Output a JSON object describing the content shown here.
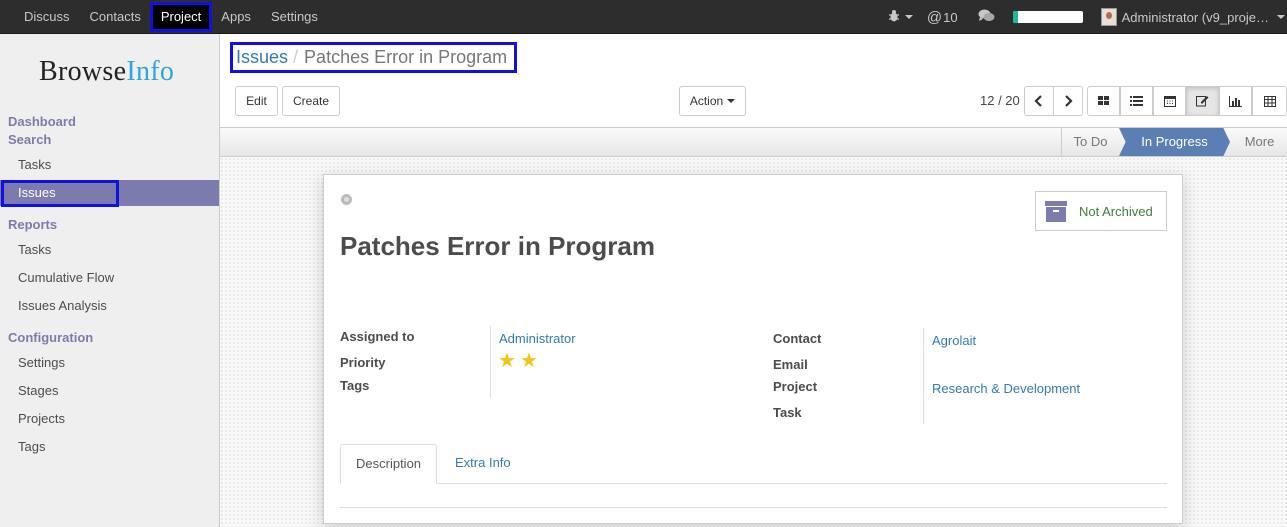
{
  "topbar": {
    "menu": [
      {
        "label": "Discuss",
        "active": false
      },
      {
        "label": "Contacts",
        "active": false
      },
      {
        "label": "Project",
        "active": true
      },
      {
        "label": "Apps",
        "active": false
      },
      {
        "label": "Settings",
        "active": false
      }
    ],
    "bug_icon": "bug-icon",
    "mentions_count": "10",
    "chat_icon": "chat-bubbles-icon",
    "progress_fraction": 0.08,
    "user_label": "Administrator (v9_proje…"
  },
  "sidebar": {
    "logo_text": "Browse",
    "logo_accent": "Info",
    "sections": [
      {
        "heading": "Dashboard"
      },
      {
        "heading": "Search",
        "items": [
          "Tasks",
          "Issues"
        ]
      },
      {
        "heading": "Reports",
        "items": [
          "Tasks",
          "Cumulative Flow",
          "Issues Analysis"
        ]
      },
      {
        "heading": "Configuration",
        "items": [
          "Settings",
          "Stages",
          "Projects",
          "Tags"
        ]
      }
    ],
    "active_item": "Issues",
    "accent_color": "#7c7bad"
  },
  "breadcrumb": {
    "parent": "Issues",
    "separator": "/",
    "current": "Patches Error in Program"
  },
  "buttons": {
    "edit": "Edit",
    "create": "Create",
    "action": "Action"
  },
  "pager": {
    "value": "12 / 20"
  },
  "views": [
    "kanban-view-icon",
    "list-view-icon",
    "calendar-view-icon",
    "form-view-icon",
    "graph-view-icon",
    "pivot-view-icon"
  ],
  "stages": {
    "todo": "To Do",
    "in_progress": "In Progress",
    "more": "More"
  },
  "record": {
    "archive_label": "Not Archived",
    "title": "Patches Error in Program",
    "fields_left": {
      "assigned_to_label": "Assigned to",
      "assigned_to_value": "Administrator",
      "priority_label": "Priority",
      "priority_stars": 2,
      "tags_label": "Tags"
    },
    "fields_right": {
      "contact_label": "Contact",
      "contact_value": "Agrolait",
      "email_label": "Email",
      "project_label": "Project",
      "project_value": "Research & Development",
      "task_label": "Task"
    },
    "tabs": {
      "description": "Description",
      "extra_info": "Extra Info"
    }
  }
}
